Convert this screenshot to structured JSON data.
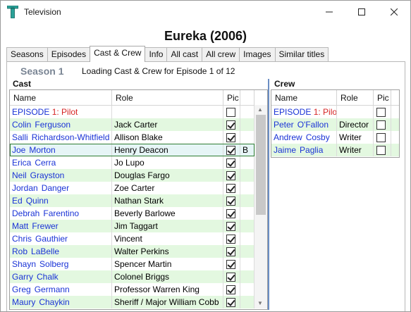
{
  "window": {
    "title": "Television"
  },
  "show_title": "Eureka (2006)",
  "tabs": [
    {
      "label": "Seasons"
    },
    {
      "label": "Episodes"
    },
    {
      "label": "Cast & Crew",
      "active": true
    },
    {
      "label": "Info"
    },
    {
      "label": "All cast"
    },
    {
      "label": "All crew"
    },
    {
      "label": "Images"
    },
    {
      "label": "Similar titles"
    }
  ],
  "season_label": "Season 1",
  "loading_text": "Loading Cast & Crew for Episode 1 of 12",
  "cast": {
    "label": "Cast",
    "columns": {
      "name": "Name",
      "role": "Role",
      "pic": "Pic"
    },
    "episode_row": {
      "prefix": "EPISODE ",
      "number": "1",
      "title": ": Pilot"
    },
    "rows": [
      {
        "first": "Colin",
        "last": "Ferguson",
        "role": "Jack Carter",
        "pic": true
      },
      {
        "first": "Salli",
        "last": "Richardson-Whitfield",
        "role": "Allison Blake",
        "pic": true
      },
      {
        "first": "Joe",
        "last": "Morton",
        "role": "Henry Deacon",
        "pic": true,
        "extra": "B",
        "selected": true
      },
      {
        "first": "Erica",
        "last": "Cerra",
        "role": "Jo Lupo",
        "pic": true
      },
      {
        "first": "Neil",
        "last": "Grayston",
        "role": "Douglas Fargo",
        "pic": true
      },
      {
        "first": "Jordan",
        "last": "Danger",
        "role": "Zoe Carter",
        "pic": true
      },
      {
        "first": "Ed",
        "last": "Quinn",
        "role": "Nathan Stark",
        "pic": true
      },
      {
        "first": "Debrah",
        "last": "Farentino",
        "role": "Beverly Barlowe",
        "pic": true
      },
      {
        "first": "Matt",
        "last": "Frewer",
        "role": "Jim Taggart",
        "pic": true
      },
      {
        "first": "Chris",
        "last": "Gauthier",
        "role": "Vincent",
        "pic": true
      },
      {
        "first": "Rob",
        "last": "LaBelle",
        "role": "Walter Perkins",
        "pic": true
      },
      {
        "first": "Shayn",
        "last": "Solberg",
        "role": "Spencer Martin",
        "pic": true
      },
      {
        "first": "Garry",
        "last": "Chalk",
        "role": "Colonel Briggs",
        "pic": true
      },
      {
        "first": "Greg",
        "last": "Germann",
        "role": "Professor Warren King",
        "pic": true
      },
      {
        "first": "Maury",
        "last": "Chaykin",
        "role": "Sheriff / Major William Cobb",
        "pic": true
      }
    ]
  },
  "crew": {
    "label": "Crew",
    "columns": {
      "name": "Name",
      "role": "Role",
      "pic": "Pic"
    },
    "episode_row": {
      "prefix": "EPISODE ",
      "number": "1",
      "title": ": Pilot"
    },
    "rows": [
      {
        "first": "Peter",
        "last": "O'Fallon",
        "role": "Director",
        "pic": false
      },
      {
        "first": "Andrew",
        "last": "Cosby",
        "role": "Writer",
        "pic": false
      },
      {
        "first": "Jaime",
        "last": "Paglia",
        "role": "Writer",
        "pic": false
      }
    ]
  },
  "colors": {
    "link_blue": "#1a33d6",
    "episode_red": "#d62424",
    "alt_row_green": "#e3f8e0",
    "selected_outline": "#2e7d32",
    "season_gray": "#7a8594"
  },
  "icons": {
    "app": "t-logo-icon",
    "minimize": "minimize-icon",
    "maximize": "maximize-icon",
    "close": "close-icon",
    "scroll_up": "chevron-up-icon",
    "scroll_down": "chevron-down-icon"
  }
}
